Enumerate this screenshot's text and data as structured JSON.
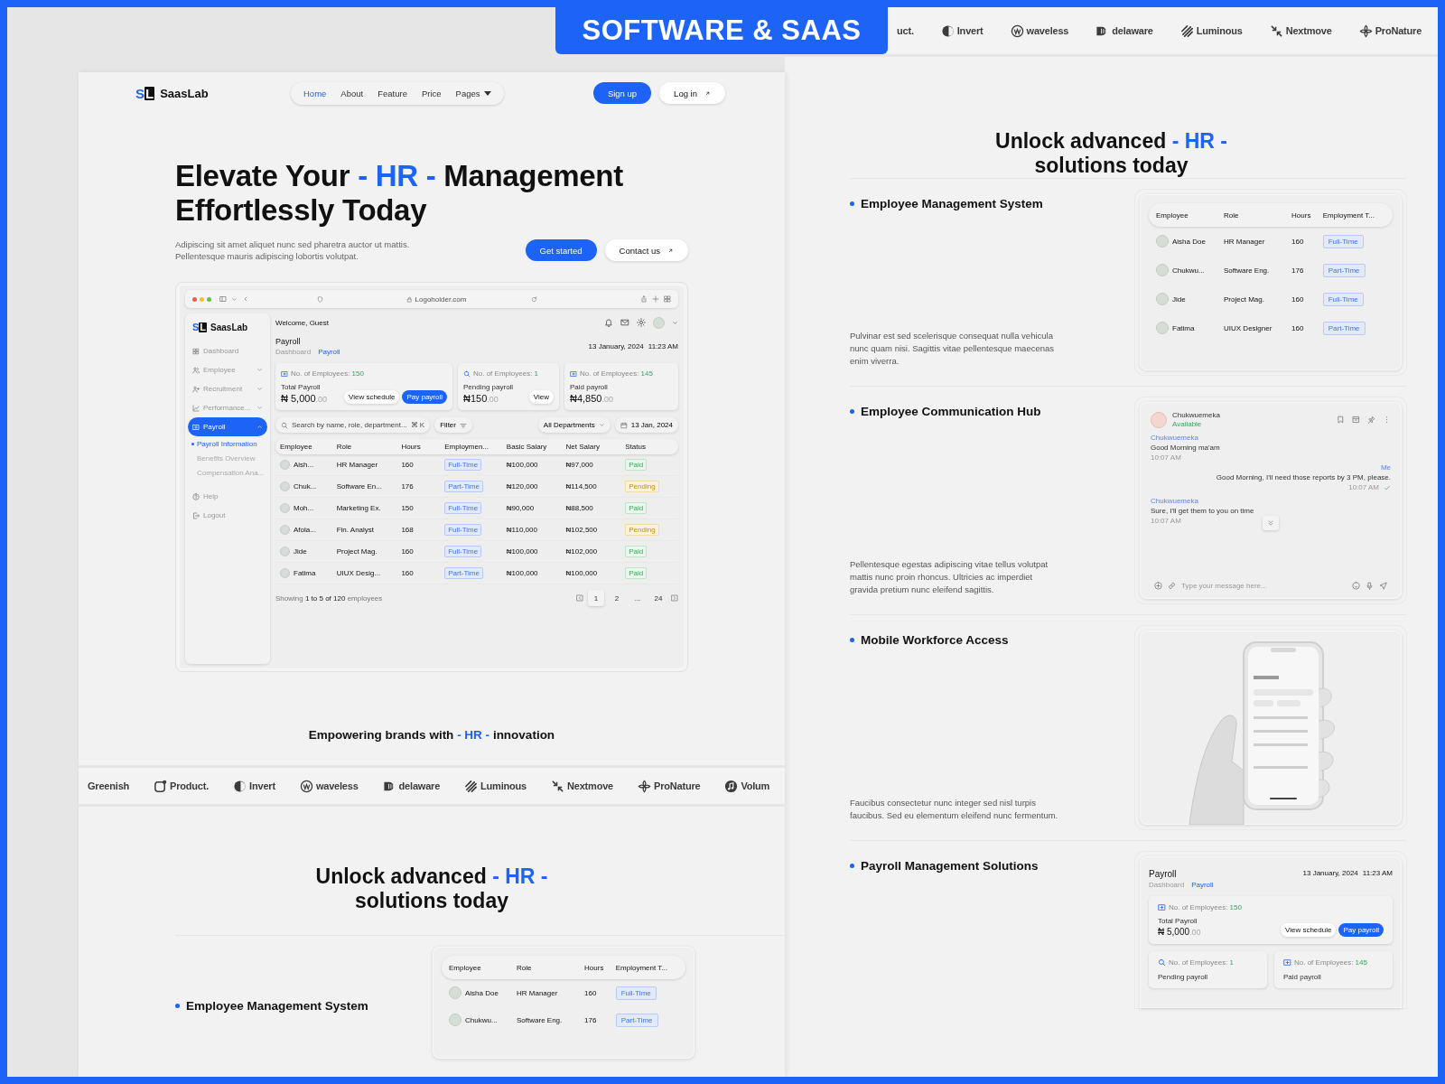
{
  "badge": "SOFTWARE & SAAS",
  "left": {
    "brand": {
      "letters": [
        "S",
        "L"
      ],
      "name": "SaasLab"
    },
    "nav": [
      {
        "label": "Home",
        "selected": true,
        "dropdown": false
      },
      {
        "label": "About",
        "selected": false,
        "dropdown": false
      },
      {
        "label": "Feature",
        "selected": false,
        "dropdown": false
      },
      {
        "label": "Price",
        "selected": false,
        "dropdown": false
      },
      {
        "label": "Pages",
        "selected": false,
        "dropdown": true
      }
    ],
    "signup": "Sign up",
    "login": "Log in",
    "hero_title": [
      [
        {
          "text": "Elevate Your ",
          "accent": false
        },
        {
          "text": "- HR -",
          "accent": true
        },
        {
          "text": " Management",
          "accent": false
        }
      ],
      [
        {
          "text": "Effortlessly Today",
          "accent": false
        }
      ]
    ],
    "hero_text": "Adipiscing sit amet aliquet nunc sed pharetra auctor ut mattis. Pellentesque mauris adipiscing lobortis volutpat.",
    "cta_primary": "Get started",
    "cta_secondary": "Contact us",
    "dashboard": {
      "url": "Logoholder.com",
      "brand": {
        "letters": [
          "S",
          "L"
        ],
        "name": "SaasLab"
      },
      "welcome": "Welcome, Guest",
      "menu": [
        {
          "label": "Dashboard",
          "selected": false
        },
        {
          "label": "Employee",
          "selected": false,
          "expanded": false
        },
        {
          "label": "Recruitment",
          "selected": false,
          "expanded": false
        },
        {
          "label": "Performance...",
          "selected": false,
          "expanded": false
        },
        {
          "label": "Payroll",
          "selected": true,
          "expanded": true,
          "children": [
            {
              "label": "Payroll Information",
              "selected": true
            },
            {
              "label": "Benefits Overview",
              "selected": false
            },
            {
              "label": "Compensation Ana...",
              "selected": false
            }
          ]
        }
      ],
      "menu_bottom": [
        "Help",
        "Logout"
      ],
      "page_title": "Payroll",
      "breadcrumb": [
        "Dashboard",
        "Payroll"
      ],
      "date": "13 January, 2024",
      "time": "11:23 AM",
      "stats": [
        {
          "label": "No. of Employees:",
          "count": "150",
          "title": "Total Payroll",
          "amount": "₦ 5,000",
          "cents": ".00",
          "buttons": [
            {
              "label": "View schedule",
              "primary": false
            },
            {
              "label": "Pay payroll",
              "primary": true
            }
          ]
        },
        {
          "label": "No. of Employees:",
          "count": "1",
          "title": "Pending payroll",
          "amount": "₦150",
          "cents": ".00",
          "buttons": [
            {
              "label": "View",
              "primary": false
            }
          ]
        },
        {
          "label": "No. of Employees:",
          "count": "145",
          "title": "Paid payroll",
          "amount": "₦4,850",
          "cents": ".00"
        }
      ],
      "search_placeholder": "Search by name, role, department...",
      "shortcut": "⌘ K",
      "filter": "Filter",
      "department": "All Departments",
      "date_filter": "13 Jan, 2024",
      "columns": [
        "Employee",
        "Role",
        "Hours",
        "Employmen...",
        "Basic Salary",
        "Net Salary",
        "Status"
      ],
      "rows": [
        {
          "name": "Aish...",
          "role": "HR Manager",
          "hours": "160",
          "type": "Full-Time",
          "basic": "₦100,000",
          "net": "₦97,000",
          "status": "Paid",
          "kind": "paid"
        },
        {
          "name": "Chuk...",
          "role": "Software En...",
          "hours": "176",
          "type": "Part-Time",
          "basic": "₦120,000",
          "net": "₦114,500",
          "status": "Pending",
          "kind": "pending"
        },
        {
          "name": "Moh...",
          "role": "Marketing Ex.",
          "hours": "150",
          "type": "Full-Time",
          "basic": "₦90,000",
          "net": "₦88,500",
          "status": "Paid",
          "kind": "paid"
        },
        {
          "name": "Afola...",
          "role": "Fin. Analyst",
          "hours": "168",
          "type": "Full-Time",
          "basic": "₦110,000",
          "net": "₦102,500",
          "status": "Pending",
          "kind": "pending"
        },
        {
          "name": "Jide",
          "role": "Project Mag.",
          "hours": "160",
          "type": "Full-Time",
          "basic": "₦100,000",
          "net": "₦102,000",
          "status": "Paid",
          "kind": "paid"
        },
        {
          "name": "Fatima",
          "role": "UIUX Desig...",
          "hours": "160",
          "type": "Part-Time",
          "basic": "₦100,000",
          "net": "₦100,000",
          "status": "Paid",
          "kind": "paid"
        }
      ],
      "showing": [
        "Showing",
        "1 to 5 of 120",
        "employees"
      ],
      "pages": [
        {
          "label": "1",
          "selected": true
        },
        {
          "label": "2",
          "selected": false
        },
        {
          "label": "...",
          "selected": false
        },
        {
          "label": "24",
          "selected": false
        }
      ]
    },
    "tagline": [
      {
        "text": "Empowering brands with ",
        "accent": false
      },
      {
        "text": "- HR -",
        "accent": true
      },
      {
        "text": " innovation",
        "accent": false
      }
    ],
    "logos": [
      {
        "name": "Greenish",
        "kind": "none"
      },
      {
        "name": "Product.",
        "kind": "square"
      },
      {
        "name": "Invert",
        "kind": "half"
      },
      {
        "name": "waveless",
        "kind": "wave"
      },
      {
        "name": "delaware",
        "kind": "bars"
      },
      {
        "name": "Luminous",
        "kind": "stripes"
      },
      {
        "name": "Nextmove",
        "kind": "arrows"
      },
      {
        "name": "ProNature",
        "kind": "flower"
      },
      {
        "name": "Volum",
        "kind": "note"
      }
    ],
    "section_title": [
      [
        {
          "text": "Unlock advanced ",
          "accent": false
        },
        {
          "text": "- HR -",
          "accent": true
        }
      ],
      [
        {
          "text": "solutions today",
          "accent": false
        }
      ]
    ],
    "feature": {
      "title": "Employee Management System",
      "columns": [
        "Employee",
        "Role",
        "Hours",
        "Employment T..."
      ],
      "rows": [
        {
          "name": "Aisha Doe",
          "role": "HR Manager",
          "hours": "160",
          "type": "Full-Time"
        },
        {
          "name": "Chukwu...",
          "role": "Software Eng.",
          "hours": "176",
          "type": "Part-Time"
        }
      ]
    }
  },
  "right": {
    "logos": [
      {
        "name": "uct.",
        "kind": "none"
      },
      {
        "name": "Invert",
        "kind": "half"
      },
      {
        "name": "waveless",
        "kind": "wave"
      },
      {
        "name": "delaware",
        "kind": "bars"
      },
      {
        "name": "Luminous",
        "kind": "stripes"
      },
      {
        "name": "Nextmove",
        "kind": "arrows"
      },
      {
        "name": "ProNature",
        "kind": "flower"
      }
    ],
    "section_title": [
      [
        {
          "text": "Unlock advanced ",
          "accent": false
        },
        {
          "text": "- HR -",
          "accent": true
        }
      ],
      [
        {
          "text": "solutions today",
          "accent": false
        }
      ]
    ],
    "features": [
      {
        "kind": "table",
        "title": "Employee Management System",
        "text": "Pulvinar est sed scelerisque consequat nulla vehicula nunc quam nisi. Sagittis vitae pellentesque maecenas enim viverra.",
        "columns": [
          "Employee",
          "Role",
          "Hours",
          "Employment T..."
        ],
        "rows": [
          {
            "name": "Aisha Doe",
            "role": "HR Manager",
            "hours": "160",
            "type": "Full-Time"
          },
          {
            "name": "Chukwu...",
            "role": "Software Eng.",
            "hours": "176",
            "type": "Part-Time"
          },
          {
            "name": "Jide",
            "role": "Project Mag.",
            "hours": "160",
            "type": "Full-Time"
          },
          {
            "name": "Fatima",
            "role": "UIUX Designer",
            "hours": "160",
            "type": "Part-Time"
          }
        ]
      },
      {
        "kind": "chat",
        "title": "Employee Communication Hub",
        "text": "Pellentesque egestas adipiscing vitae tellus volutpat mattis nunc proin rhoncus. Ultricies ac imperdiet gravida pretium nunc eleifend sagittis.",
        "contact": "Chukwuemeka",
        "presence": "Available",
        "messages": [
          {
            "sender": "Chukwuemeka",
            "text": "Good Morning ma'am",
            "time": "10:07 AM",
            "mine": false
          },
          {
            "sender": "Me",
            "text": "Good Morning, I'll need those reports by 3 PM, please.",
            "time": "10:07 AM",
            "mine": true
          },
          {
            "sender": "Chukwuemeka",
            "text": "Sure, I'll get them to you on time",
            "time": "10:07 AM",
            "mine": false
          }
        ],
        "placeholder": "Type your message here..."
      },
      {
        "kind": "phone",
        "title": "Mobile Workforce Access",
        "text": "Faucibus consectetur nunc integer sed nisl turpis faucibus. Sed eu elementum eleifend nunc fermentum."
      },
      {
        "kind": "payroll",
        "title": "Payroll Management Solutions",
        "page_title": "Payroll",
        "breadcrumb": [
          "Dashboard",
          "Payroll"
        ],
        "date": "13 January, 2024",
        "time": "11:23 AM",
        "main": {
          "label": "No. of Employees:",
          "count": "150",
          "title": "Total Payroll",
          "amount": "₦ 5,000",
          "cents": ".00",
          "buttons": [
            {
              "label": "View schedule",
              "primary": false
            },
            {
              "label": "Pay payroll",
              "primary": true
            }
          ]
        },
        "minor": [
          {
            "label": "No. of Employees:",
            "count": "1",
            "title": "Pending payroll"
          },
          {
            "label": "No. of Employees:",
            "count": "145",
            "title": "Paid payroll"
          }
        ]
      }
    ]
  }
}
